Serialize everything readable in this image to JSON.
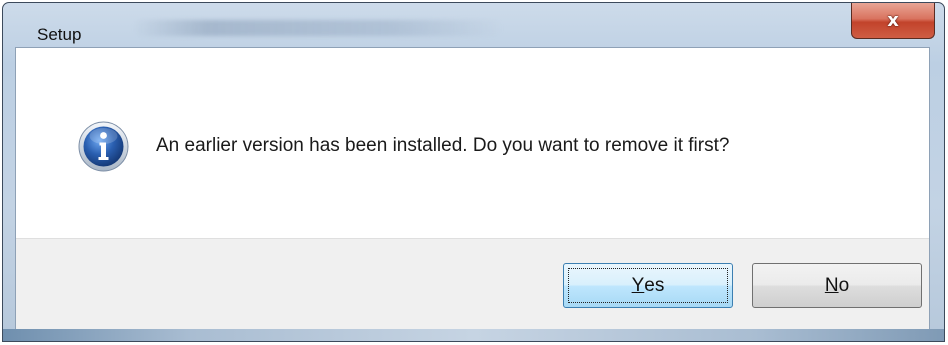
{
  "window": {
    "title": "Setup",
    "close_symbol": "x"
  },
  "dialog": {
    "icon": "information-icon",
    "message": "An earlier version has been installed. Do you want to remove it first?"
  },
  "buttons": {
    "yes": {
      "accel": "Y",
      "rest": "es"
    },
    "no": {
      "accel": "N",
      "rest": "o"
    }
  },
  "colors": {
    "title_bar": "#bccfe3",
    "close_button": "#c2432b",
    "button_area": "#f0f0f0",
    "default_button": "#bee6fd",
    "info_icon": "#2a5fb0"
  }
}
